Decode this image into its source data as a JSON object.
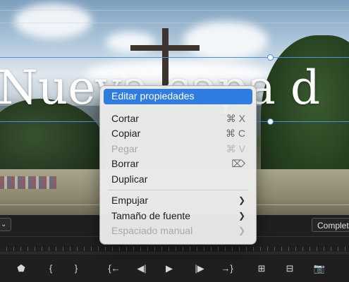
{
  "video": {
    "title_text": "Nueva capa d"
  },
  "context_menu": {
    "edit_properties": "Editar propiedades",
    "cut": {
      "label": "Cortar",
      "shortcut": "⌘ X"
    },
    "copy": {
      "label": "Copiar",
      "shortcut": "⌘ C"
    },
    "paste": {
      "label": "Pegar",
      "shortcut": "⌘ V",
      "enabled": false
    },
    "delete": {
      "label": "Borrar",
      "shortcut": "⌦"
    },
    "duplicate": {
      "label": "Duplicar"
    },
    "push": {
      "label": "Empujar",
      "submenu_icon": "chevron-right-icon"
    },
    "font_size": {
      "label": "Tamaño de fuente",
      "submenu_icon": "chevron-right-icon"
    },
    "manual_spacing": {
      "label": "Espaciado manual",
      "submenu_icon": "chevron-right-icon",
      "enabled": false
    }
  },
  "panel": {
    "zoom_chevron": "⌄",
    "quality_label": "Complet"
  },
  "controls": {
    "add_marker": "⬟",
    "mark_in": "{",
    "mark_out": "}",
    "go_to_in": "{←",
    "step_back": "◀|",
    "play": "▶",
    "step_forward": "|▶",
    "go_to_out": "→}",
    "insert": "⊞",
    "overwrite": "⊟",
    "export_frame": "📷"
  },
  "colors": {
    "selection": "#2f7de1",
    "guide": "#4a90e2",
    "menu_bg": "#ececec"
  }
}
